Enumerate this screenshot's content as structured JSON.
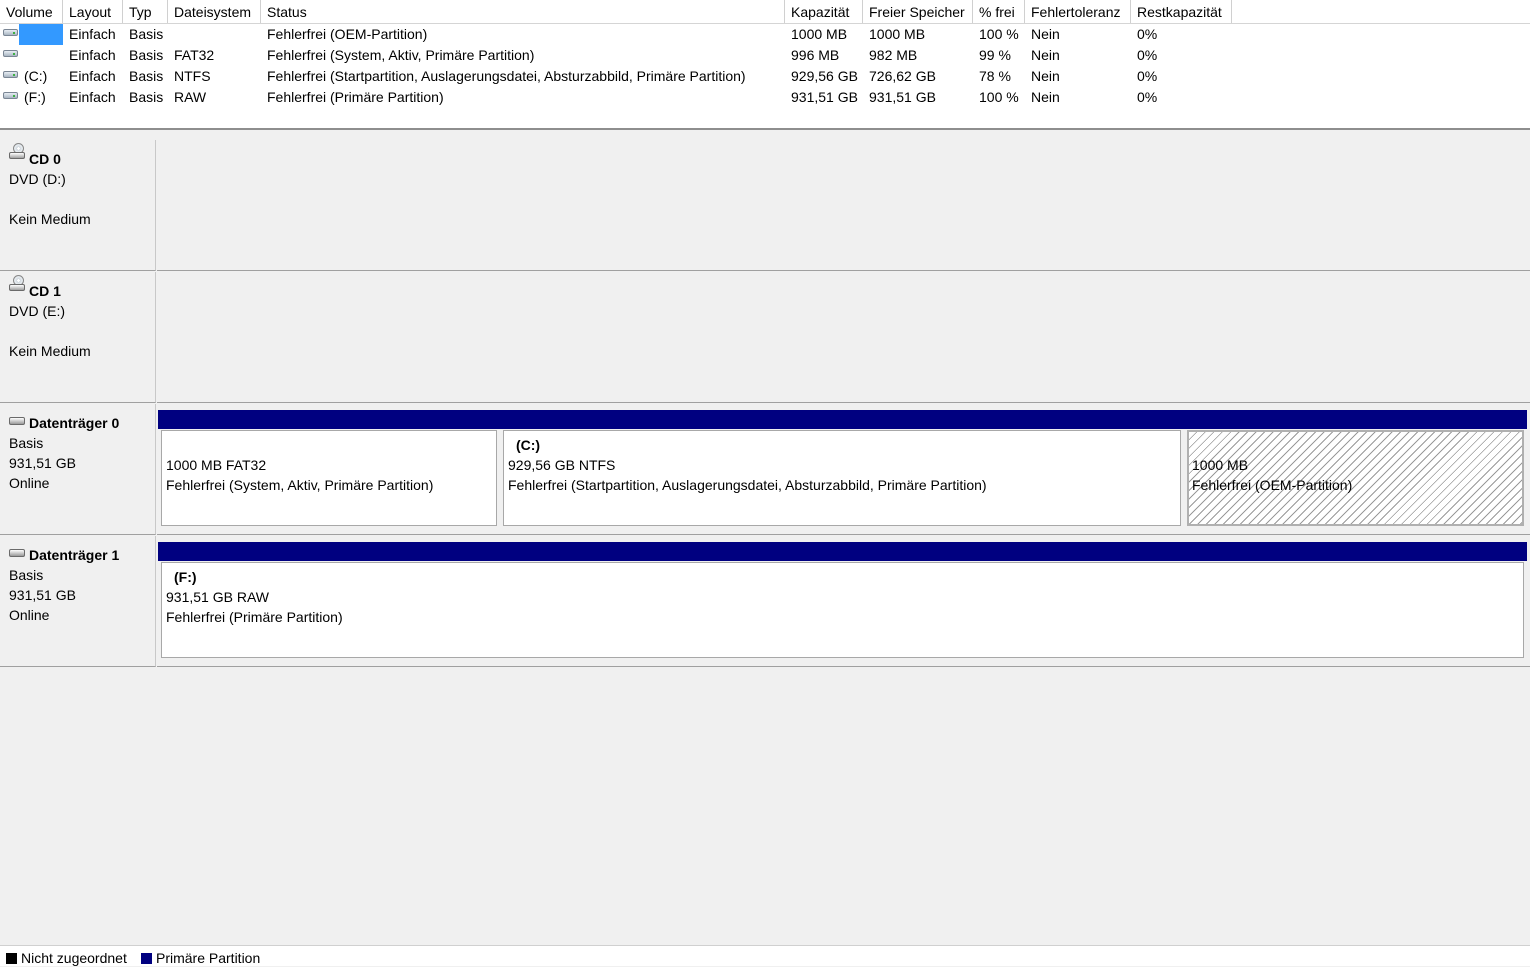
{
  "columns": [
    "Volume",
    "Layout",
    "Typ",
    "Dateisystem",
    "Status",
    "Kapazität",
    "Freier Speicher",
    "% frei",
    "Fehlertoleranz",
    "Restkapazität"
  ],
  "volumes": [
    {
      "volume": "",
      "layout": "Einfach",
      "typ": "Basis",
      "fs": "",
      "status": "Fehlerfrei (OEM-Partition)",
      "kap": "1000 MB",
      "frei": "1000 MB",
      "pct": "100 %",
      "tol": "Nein",
      "rest": "0%"
    },
    {
      "volume": "",
      "layout": "Einfach",
      "typ": "Basis",
      "fs": "FAT32",
      "status": "Fehlerfrei (System, Aktiv, Primäre Partition)",
      "kap": "996 MB",
      "frei": "982 MB",
      "pct": "99 %",
      "tol": "Nein",
      "rest": "0%"
    },
    {
      "volume": "(C:)",
      "layout": "Einfach",
      "typ": "Basis",
      "fs": "NTFS",
      "status": "Fehlerfrei (Startpartition, Auslagerungsdatei, Absturzabbild, Primäre Partition)",
      "kap": "929,56 GB",
      "frei": "726,62 GB",
      "pct": "78 %",
      "tol": "Nein",
      "rest": "0%"
    },
    {
      "volume": "(F:)",
      "layout": "Einfach",
      "typ": "Basis",
      "fs": "RAW",
      "status": "Fehlerfrei (Primäre Partition)",
      "kap": "931,51 GB",
      "frei": "931,51 GB",
      "pct": "100 %",
      "tol": "Nein",
      "rest": "0%"
    }
  ],
  "cd0": {
    "name": "CD 0",
    "line1": "DVD (D:)",
    "line2": "Kein Medium"
  },
  "cd1": {
    "name": "CD 1",
    "line1": "DVD (E:)",
    "line2": "Kein Medium"
  },
  "disk0": {
    "name": "Datenträger 0",
    "type": "Basis",
    "size": "931,51 GB",
    "state": "Online",
    "parts": [
      {
        "label": "",
        "line1": "1000 MB FAT32",
        "line2": "Fehlerfrei (System, Aktiv, Primäre Partition)"
      },
      {
        "label": "(C:)",
        "line1": "929,56 GB NTFS",
        "line2": "Fehlerfrei (Startpartition, Auslagerungsdatei, Absturzabbild, Primäre Partition)"
      },
      {
        "label": "",
        "line1": "1000 MB",
        "line2": "Fehlerfrei (OEM-Partition)"
      }
    ]
  },
  "disk1": {
    "name": "Datenträger 1",
    "type": "Basis",
    "size": "931,51 GB",
    "state": "Online",
    "parts": [
      {
        "label": "(F:)",
        "line1": "931,51 GB RAW",
        "line2": "Fehlerfrei (Primäre Partition)"
      }
    ]
  },
  "legend": {
    "unallocated": "Nicht zugeordnet",
    "primary": "Primäre Partition"
  },
  "colors": {
    "primary": "#000080",
    "unallocated": "#000000",
    "selection": "#3399ff"
  }
}
